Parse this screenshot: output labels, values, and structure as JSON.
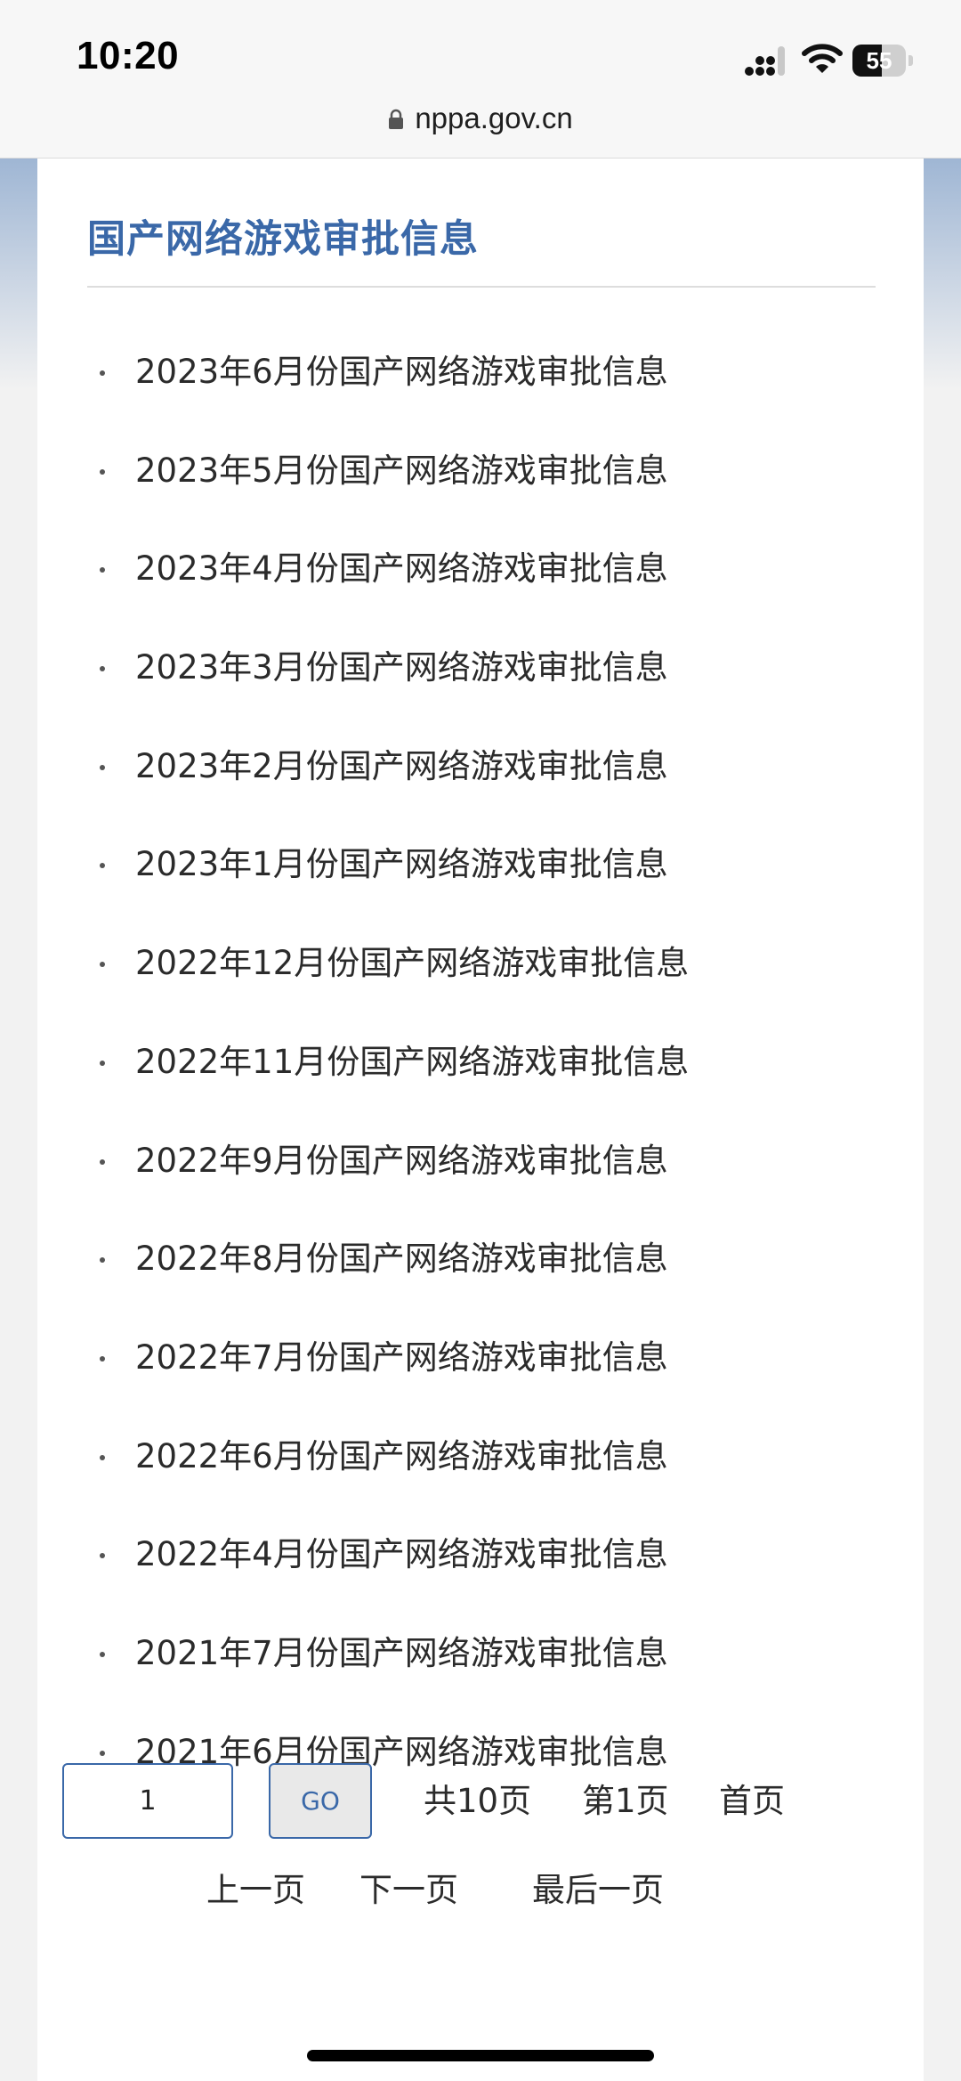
{
  "status_bar": {
    "time": "10:20",
    "battery_level": "55",
    "battery_fraction": 0.55
  },
  "browser": {
    "url": "nppa.gov.cn"
  },
  "colors": {
    "accent": "#3a68a8",
    "text": "#2b2b2b"
  },
  "section": {
    "title": "国产网络游戏审批信息"
  },
  "items": [
    "2023年6月份国产网络游戏审批信息",
    "2023年5月份国产网络游戏审批信息",
    "2023年4月份国产网络游戏审批信息",
    "2023年3月份国产网络游戏审批信息",
    "2023年2月份国产网络游戏审批信息",
    "2023年1月份国产网络游戏审批信息",
    "2022年12月份国产网络游戏审批信息",
    "2022年11月份国产网络游戏审批信息",
    "2022年9月份国产网络游戏审批信息",
    "2022年8月份国产网络游戏审批信息",
    "2022年7月份国产网络游戏审批信息",
    "2022年6月份国产网络游戏审批信息",
    "2022年4月份国产网络游戏审批信息",
    "2021年7月份国产网络游戏审批信息",
    "2021年6月份国产网络游戏审批信息"
  ],
  "pagination": {
    "page_input_value": "1",
    "go_label": "GO",
    "total_pages": "共10页",
    "current_page": "第1页",
    "first": "首页",
    "prev": "上一页",
    "next": "下一页",
    "last": "最后一页"
  }
}
